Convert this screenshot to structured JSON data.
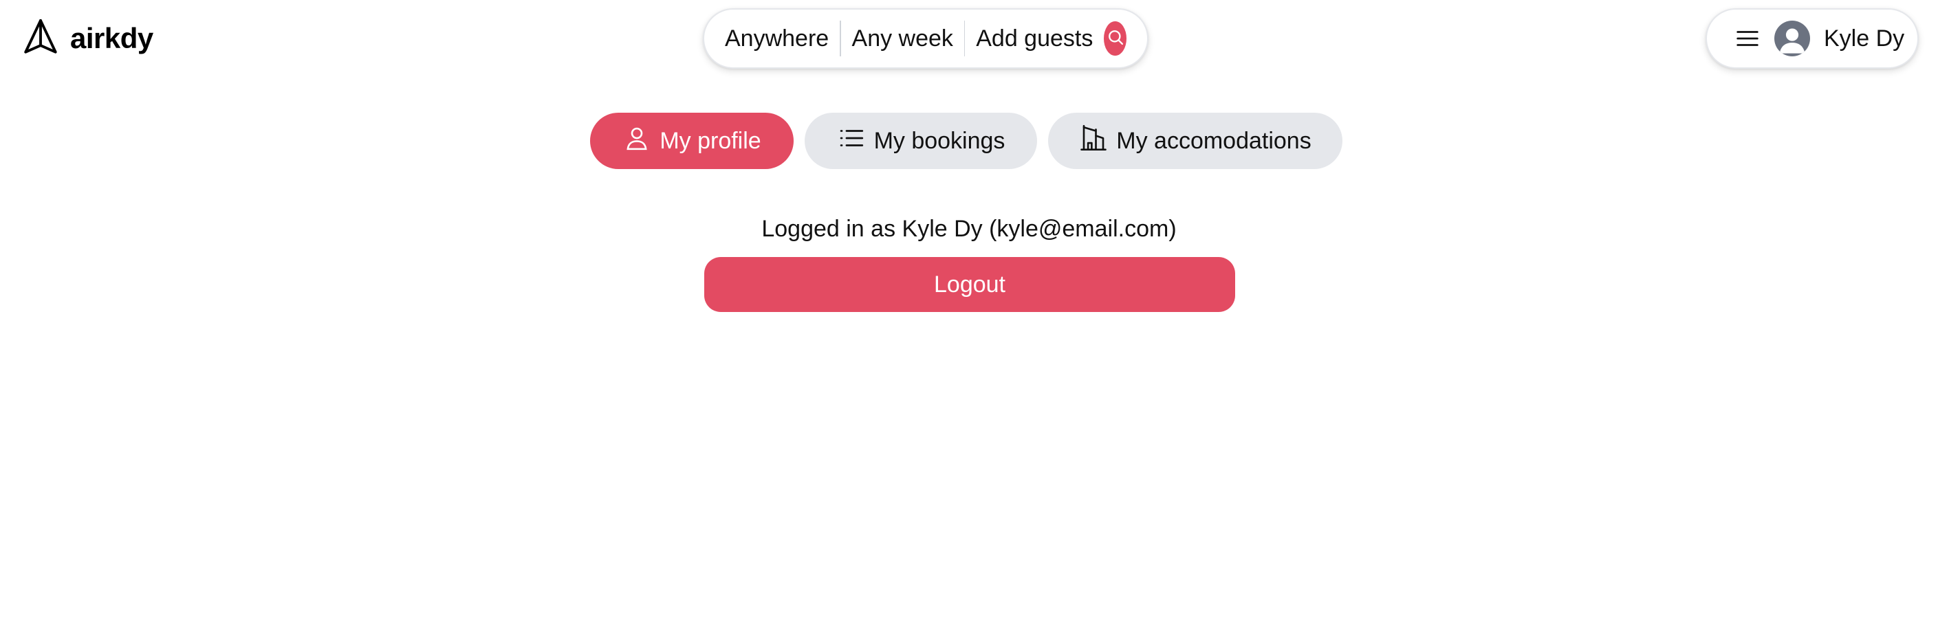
{
  "brand": {
    "name": "airkdy",
    "accent": "#e34b62",
    "icon": "paper-plane-icon"
  },
  "search": {
    "location": "Anywhere",
    "dates": "Any week",
    "guests": "Add guests",
    "button_icon": "search-icon"
  },
  "user_menu": {
    "menu_icon": "hamburger-icon",
    "avatar_icon": "user-avatar-icon",
    "name": "Kyle Dy"
  },
  "tabs": [
    {
      "label": "My profile",
      "icon": "user-icon",
      "active": true
    },
    {
      "label": "My bookings",
      "icon": "list-icon",
      "active": false
    },
    {
      "label": "My accomodations",
      "icon": "building-icon",
      "active": false
    }
  ],
  "profile": {
    "logged_in_text": "Logged in as Kyle Dy (kyle@email.com)",
    "logout_label": "Logout"
  }
}
